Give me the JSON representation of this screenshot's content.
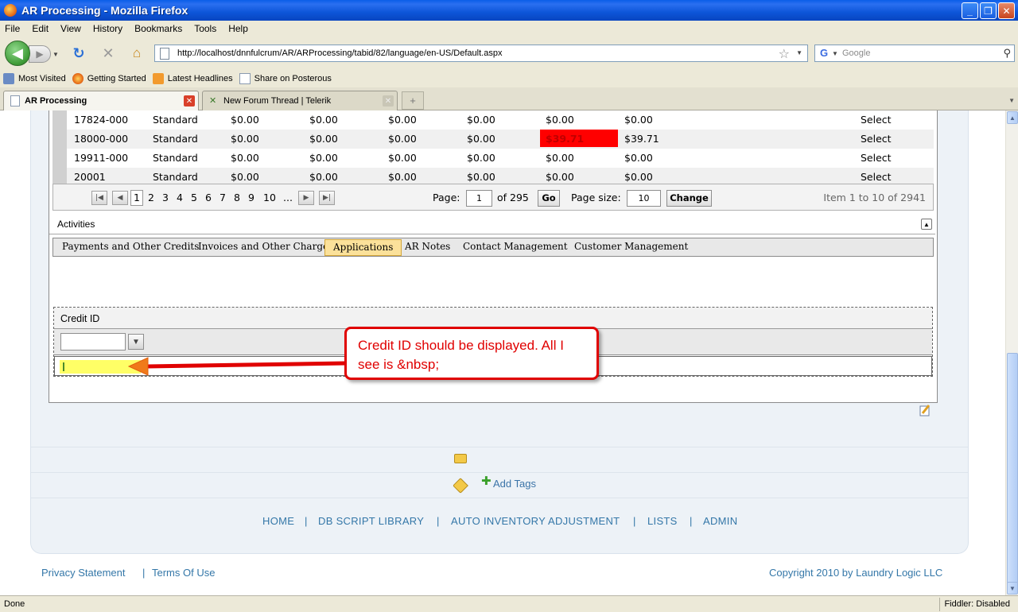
{
  "window": {
    "title": "AR Processing - Mozilla Firefox"
  },
  "menu": [
    "File",
    "Edit",
    "View",
    "History",
    "Bookmarks",
    "Tools",
    "Help"
  ],
  "navbar": {
    "url": "http://localhost/dnnfulcrum/AR/ARProcessing/tabid/82/language/en-US/Default.aspx",
    "search_placeholder": "Google"
  },
  "bookmarks": [
    "Most Visited",
    "Getting Started",
    "Latest Headlines",
    "Share on Posterous"
  ],
  "tabs": [
    {
      "label": "AR Processing",
      "active": true
    },
    {
      "label": "New Forum Thread | Telerik",
      "active": false
    }
  ],
  "grid": {
    "rows": [
      {
        "id": "17824-000",
        "type": "Standard",
        "c1": "$0.00",
        "c2": "$0.00",
        "c3": "$0.00",
        "c4": "$0.00",
        "c5": "$0.00",
        "c6": "$0.00",
        "action": "Select",
        "highlight": false
      },
      {
        "id": "18000-000",
        "type": "Standard",
        "c1": "$0.00",
        "c2": "$0.00",
        "c3": "$0.00",
        "c4": "$0.00",
        "c5": "$39.71",
        "c6": "$39.71",
        "action": "Select",
        "highlight": true
      },
      {
        "id": "19911-000",
        "type": "Standard",
        "c1": "$0.00",
        "c2": "$0.00",
        "c3": "$0.00",
        "c4": "$0.00",
        "c5": "$0.00",
        "c6": "$0.00",
        "action": "Select",
        "highlight": false
      },
      {
        "id": "20001",
        "type": "Standard",
        "c1": "$0.00",
        "c2": "$0.00",
        "c3": "$0.00",
        "c4": "$0.00",
        "c5": "$0.00",
        "c6": "$0.00",
        "action": "Select",
        "highlight": false
      }
    ]
  },
  "pager": {
    "pages": [
      "1",
      "2",
      "3",
      "4",
      "5",
      "6",
      "7",
      "8",
      "9",
      "10",
      "..."
    ],
    "page_label": "Page:",
    "page_value": "1",
    "of_label": "of 295",
    "go_label": "Go",
    "size_label": "Page size:",
    "size_value": "10",
    "change_label": "Change",
    "item_summary": "Item 1 to 10 of 2941"
  },
  "activities": {
    "title": "Activities",
    "tabs": [
      "Payments and Other Credits",
      "Invoices and Other Charges",
      "Applications",
      "AR Notes",
      "Contact Management",
      "Customer Management"
    ],
    "selected_tab": "Applications"
  },
  "credit_grid": {
    "header": "Credit ID",
    "cell_value": ""
  },
  "callout": {
    "text": "Credit ID should be displayed. All I see is &nbsp;"
  },
  "tags": {
    "add_label": "Add Tags"
  },
  "footer_nav": [
    "HOME",
    "DB SCRIPT LIBRARY",
    "AUTO INVENTORY ADJUSTMENT",
    "LISTS",
    "ADMIN"
  ],
  "footer_sep": "|",
  "footer": {
    "privacy": "Privacy Statement",
    "terms": "Terms Of Use",
    "copyright": "Copyright 2010 by Laundry Logic LLC"
  },
  "statusbar": {
    "left": "Done",
    "right": "Fiddler: Disabled"
  },
  "colors": {
    "highlight_red": "#ff0000",
    "selected_tab": "#fbe19a",
    "callout_red": "#e00000",
    "link_blue": "#3477a8"
  }
}
